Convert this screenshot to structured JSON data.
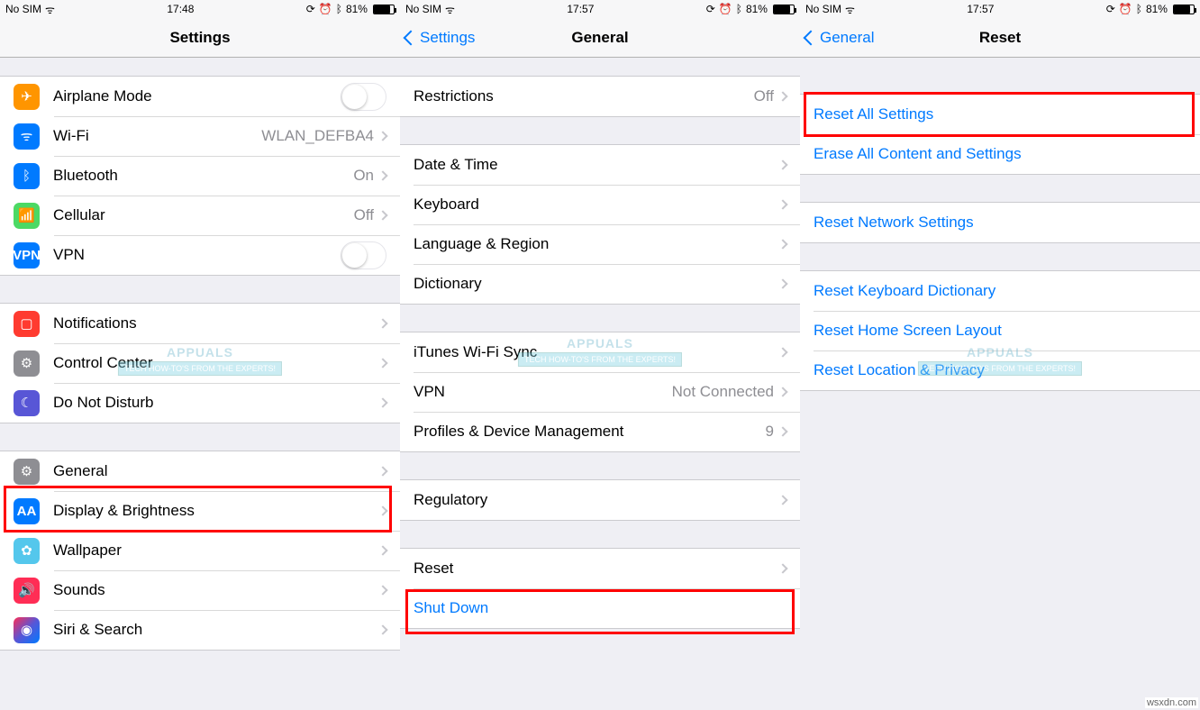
{
  "credit": "wsxdn.com",
  "status_common": {
    "sim": "No SIM",
    "batt": "81%",
    "batt_fill": "81%"
  },
  "screens": {
    "settings": {
      "time": "17:48",
      "title": "Settings",
      "back": null,
      "items": {
        "airplane": "Airplane Mode",
        "wifi": "Wi-Fi",
        "wifi_val": "WLAN_DEFBA4",
        "bt": "Bluetooth",
        "bt_val": "On",
        "cell": "Cellular",
        "cell_val": "Off",
        "vpn": "VPN",
        "notif": "Notifications",
        "cc": "Control Center",
        "dnd": "Do Not Disturb",
        "general": "General",
        "display": "Display & Brightness",
        "wallpaper": "Wallpaper",
        "sounds": "Sounds",
        "siri": "Siri & Search"
      }
    },
    "general": {
      "time": "17:57",
      "title": "General",
      "back": "Settings",
      "items": {
        "restrictions": "Restrictions",
        "restrictions_val": "Off",
        "date": "Date & Time",
        "keyboard": "Keyboard",
        "lang": "Language & Region",
        "dict": "Dictionary",
        "itunes": "iTunes Wi-Fi Sync",
        "vpn": "VPN",
        "vpn_val": "Not Connected",
        "profiles": "Profiles & Device Management",
        "profiles_val": "9",
        "regulatory": "Regulatory",
        "reset": "Reset",
        "shutdown": "Shut Down"
      }
    },
    "reset": {
      "time": "17:57",
      "title": "Reset",
      "back": "General",
      "items": {
        "all": "Reset All Settings",
        "erase": "Erase All Content and Settings",
        "net": "Reset Network Settings",
        "kbd": "Reset Keyboard Dictionary",
        "home": "Reset Home Screen Layout",
        "loc": "Reset Location & Privacy"
      }
    }
  },
  "watermark": {
    "brand": "APPUALS",
    "tag": "TECH HOW-TO'S FROM THE EXPERTS!"
  }
}
